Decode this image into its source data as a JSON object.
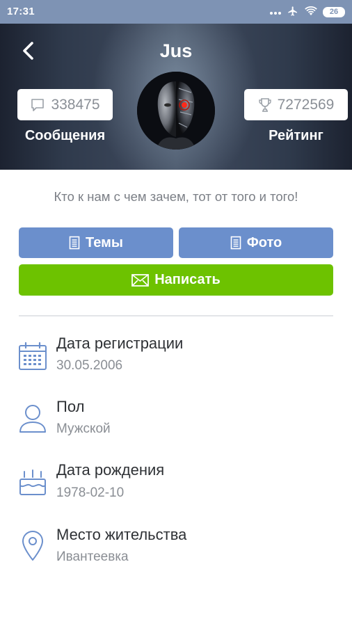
{
  "status_bar": {
    "time": "17:31",
    "battery": "26",
    "more_icon": "more-dots-icon",
    "airplane_icon": "airplane-icon",
    "wifi_icon": "wifi-icon"
  },
  "header": {
    "title": "Jus",
    "back_icon": "chevron-left-icon",
    "messages": {
      "value": "338475",
      "label": "Сообщения",
      "icon": "speech-bubble-icon"
    },
    "rating": {
      "value": "7272569",
      "label": "Рейтинг",
      "icon": "trophy-icon"
    }
  },
  "bio": "Кто к нам с чем зачем, тот от того и того!",
  "buttons": {
    "themes": "Темы",
    "photo": "Фото",
    "write": "Написать"
  },
  "info": [
    {
      "label": "Дата регистрации",
      "value": "30.05.2006",
      "icon": "calendar-icon"
    },
    {
      "label": "Пол",
      "value": "Мужской",
      "icon": "person-icon"
    },
    {
      "label": "Дата рождения",
      "value": "1978-02-10",
      "icon": "birthday-cake-icon"
    },
    {
      "label": "Место жительства",
      "value": "Ивантеевка",
      "icon": "location-pin-icon"
    }
  ],
  "colors": {
    "status_bar": "#7e93b4",
    "primary_button": "#6b8fcc",
    "write_button": "#6dc200",
    "icon_accent": "#6b8fcc"
  }
}
